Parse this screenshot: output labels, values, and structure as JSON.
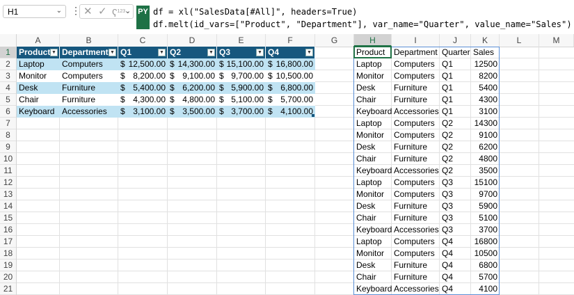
{
  "name_box": {
    "value": "H1"
  },
  "formula_bar": {
    "badge": "PY",
    "line1": "df = xl(\"SalesData[#All]\", headers=True)",
    "line2": "df.melt(id_vars=[\"Product\", \"Department\"], var_name=\"Quarter\", value_name=\"Sales\")",
    "tool_cancel": "✕",
    "tool_enter": "✓",
    "tool_python": "ʕ",
    "tool_python_sup": "123"
  },
  "columns": [
    "A",
    "B",
    "C",
    "D",
    "E",
    "F",
    "G",
    "H",
    "I",
    "J",
    "K",
    "L",
    "M"
  ],
  "rows": [
    "1",
    "2",
    "3",
    "4",
    "5",
    "6",
    "7",
    "8",
    "9",
    "10",
    "11",
    "12",
    "13",
    "14",
    "15",
    "16",
    "17",
    "18",
    "19",
    "20",
    "21"
  ],
  "sales_table": {
    "headers": [
      "Product",
      "Department",
      "Q1",
      "Q2",
      "Q3",
      "Q4"
    ],
    "currency_symbol": "$",
    "rows": [
      [
        "Laptop",
        "Computers",
        "12,500.00",
        "14,300.00",
        "15,100.00",
        "16,800.00"
      ],
      [
        "Monitor",
        "Computers",
        "8,200.00",
        "9,100.00",
        "9,700.00",
        "10,500.00"
      ],
      [
        "Desk",
        "Furniture",
        "5,400.00",
        "6,200.00",
        "5,900.00",
        "6,800.00"
      ],
      [
        "Chair",
        "Furniture",
        "4,300.00",
        "4,800.00",
        "5,100.00",
        "5,700.00"
      ],
      [
        "Keyboard",
        "Accessories",
        "3,100.00",
        "3,500.00",
        "3,700.00",
        "4,100.00"
      ]
    ],
    "colors": {
      "header": "#16577e",
      "band": "#c0e3f3"
    }
  },
  "output": {
    "headers": [
      "Product",
      "Department",
      "Quarter",
      "Sales"
    ],
    "rows": [
      [
        "Laptop",
        "Computers",
        "Q1",
        "12500"
      ],
      [
        "Monitor",
        "Computers",
        "Q1",
        "8200"
      ],
      [
        "Desk",
        "Furniture",
        "Q1",
        "5400"
      ],
      [
        "Chair",
        "Furniture",
        "Q1",
        "4300"
      ],
      [
        "Keyboard",
        "Accessories",
        "Q1",
        "3100"
      ],
      [
        "Laptop",
        "Computers",
        "Q2",
        "14300"
      ],
      [
        "Monitor",
        "Computers",
        "Q2",
        "9100"
      ],
      [
        "Desk",
        "Furniture",
        "Q2",
        "6200"
      ],
      [
        "Chair",
        "Furniture",
        "Q2",
        "4800"
      ],
      [
        "Keyboard",
        "Accessories",
        "Q2",
        "3500"
      ],
      [
        "Laptop",
        "Computers",
        "Q3",
        "15100"
      ],
      [
        "Monitor",
        "Computers",
        "Q3",
        "9700"
      ],
      [
        "Desk",
        "Furniture",
        "Q3",
        "5900"
      ],
      [
        "Chair",
        "Furniture",
        "Q3",
        "5100"
      ],
      [
        "Keyboard",
        "Accessories",
        "Q3",
        "3700"
      ],
      [
        "Laptop",
        "Computers",
        "Q4",
        "16800"
      ],
      [
        "Monitor",
        "Computers",
        "Q4",
        "10500"
      ],
      [
        "Desk",
        "Furniture",
        "Q4",
        "6800"
      ],
      [
        "Chair",
        "Furniture",
        "Q4",
        "5700"
      ],
      [
        "Keyboard",
        "Accessories",
        "Q4",
        "4100"
      ]
    ]
  },
  "accent_color": "#1e7145"
}
